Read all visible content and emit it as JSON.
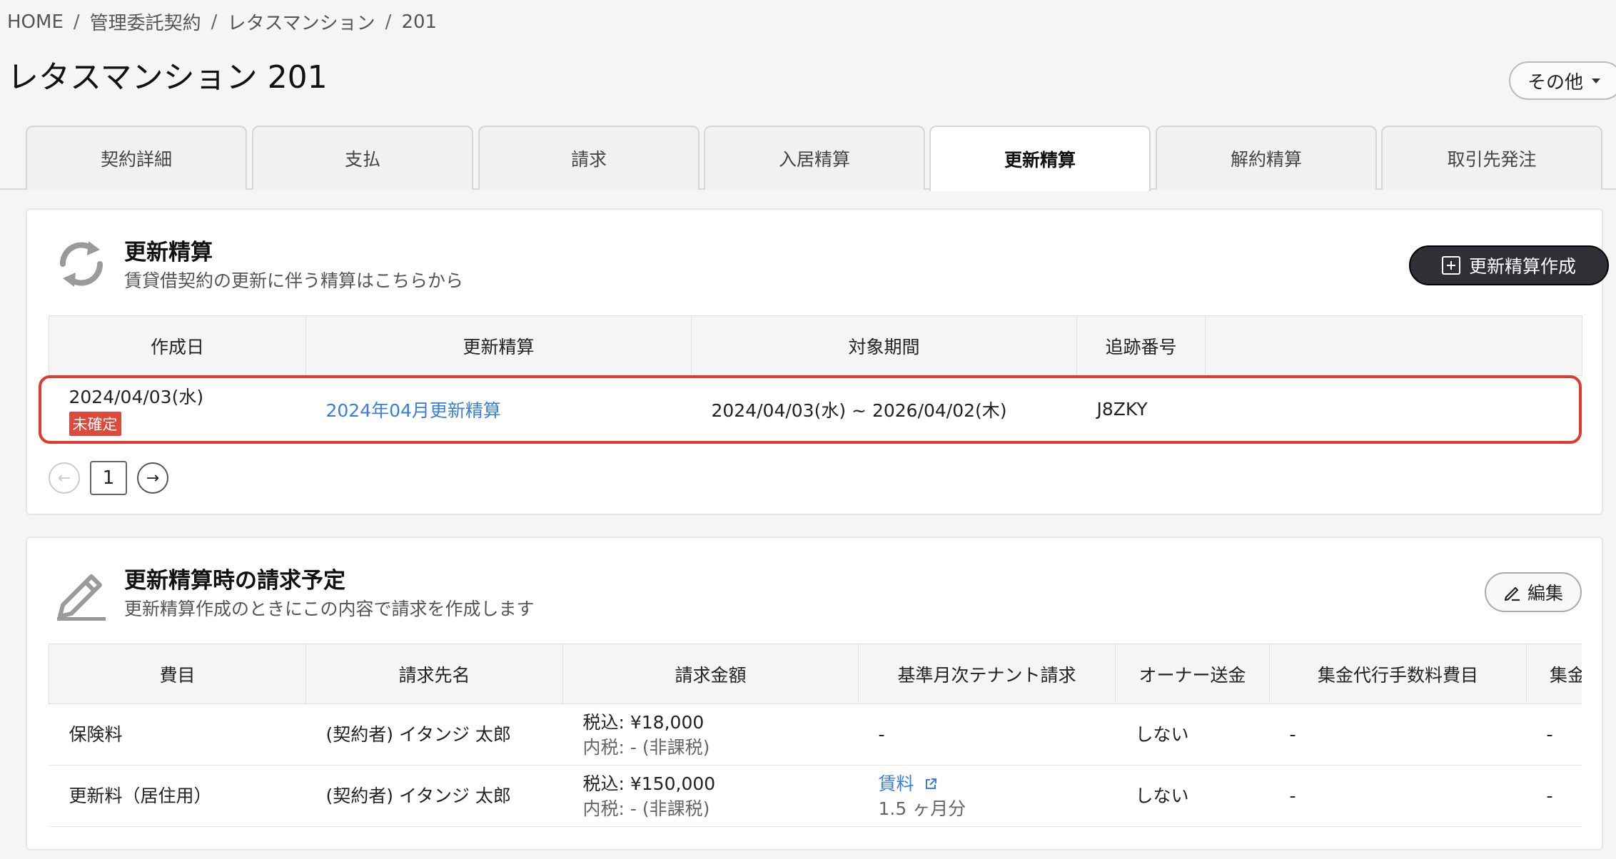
{
  "breadcrumb": {
    "items": [
      "HOME",
      "管理委託契約",
      "レタスマンション",
      "201"
    ],
    "separator": "/"
  },
  "page_title": "レタスマンション 201",
  "header": {
    "more_label": "その他"
  },
  "tabs": [
    {
      "label": "契約詳細",
      "active": false
    },
    {
      "label": "支払",
      "active": false
    },
    {
      "label": "請求",
      "active": false
    },
    {
      "label": "入居精算",
      "active": false
    },
    {
      "label": "更新精算",
      "active": true
    },
    {
      "label": "解約精算",
      "active": false
    },
    {
      "label": "取引先発注",
      "active": false
    }
  ],
  "renewal": {
    "title": "更新精算",
    "subtitle": "賃貸借契約の更新に伴う精算はこちらから",
    "create_label": "更新精算作成",
    "columns": [
      "作成日",
      "更新精算",
      "対象期間",
      "追跡番号",
      ""
    ],
    "rows": [
      {
        "created": "2024/04/03(水)",
        "status": "未確定",
        "name": "2024年04月更新精算",
        "period": "2024/04/03(水) ~ 2026/04/02(木)",
        "tracking": "J8ZKY"
      }
    ],
    "pagination": {
      "current": "1",
      "prev": "←",
      "next": "→"
    }
  },
  "billing": {
    "title": "更新精算時の請求予定",
    "subtitle": "更新精算作成のときにこの内容で請求を作成します",
    "edit_label": "編集",
    "columns": [
      "費目",
      "請求先名",
      "請求金額",
      "基準月次テナント請求",
      "オーナー送金",
      "集金代行手数料費目",
      "集金"
    ],
    "rows": [
      {
        "item": "保険料",
        "payee": "(契約者) イタンジ 太郎",
        "amount": "税込: ¥18,000",
        "tax": "内税: - (非課税)",
        "base_link": "",
        "base_extra": "-",
        "owner": "しない",
        "fee_item": "-",
        "last": "-"
      },
      {
        "item": "更新料（居住用）",
        "payee": "(契約者) イタンジ 太郎",
        "amount": "税込: ¥150,000",
        "tax": "内税: - (非課税)",
        "base_link": "賃料",
        "base_extra": "1.5 ヶ月分",
        "owner": "しない",
        "fee_item": "-",
        "last": "-"
      }
    ]
  },
  "colors": {
    "accent_dark": "#2f3036",
    "link": "#3a7ed8",
    "badge_red": "#dd4a3b",
    "highlight_red": "#e03a2f"
  }
}
